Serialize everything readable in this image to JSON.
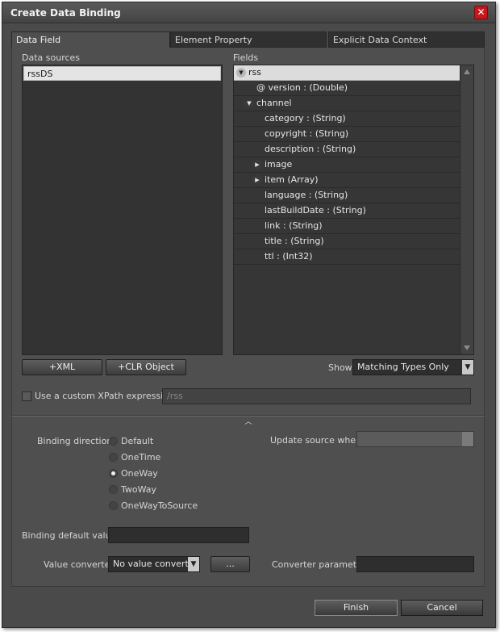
{
  "window": {
    "title": "Create Data Binding",
    "close_glyph": "✕"
  },
  "tabs": [
    {
      "label": "Data Field",
      "active": true
    },
    {
      "label": "Element Property",
      "active": false
    },
    {
      "label": "Explicit Data Context",
      "active": false
    }
  ],
  "data_sources": {
    "label": "Data sources",
    "items": [
      "rssDS"
    ],
    "selected": "rssDS"
  },
  "fields": {
    "label": "Fields",
    "rows": [
      {
        "text": "rss",
        "expander": "collapse-icon",
        "selected": true
      },
      {
        "text": "@ version : (Double)"
      },
      {
        "text": "channel",
        "expander": "collapse-icon"
      },
      {
        "text": "category : (String)"
      },
      {
        "text": "copyright : (String)"
      },
      {
        "text": "description : (String)"
      },
      {
        "text": "image",
        "expander": "expand-icon"
      },
      {
        "text": "item (Array)",
        "expander": "expand-icon"
      },
      {
        "text": "language : (String)"
      },
      {
        "text": "lastBuildDate : (String)"
      },
      {
        "text": "link : (String)"
      },
      {
        "text": "title : (String)"
      },
      {
        "text": "ttl : (Int32)"
      }
    ]
  },
  "buttons": {
    "add_xml": "+XML",
    "add_clr": "+CLR Object",
    "ellipsis": "...",
    "finish": "Finish",
    "cancel": "Cancel"
  },
  "show": {
    "label": "Show",
    "value": "Matching Types Only"
  },
  "xpath": {
    "label": "Use a custom XPath expression",
    "checked": false,
    "value": "/rss"
  },
  "binding_direction": {
    "label": "Binding direction",
    "options": [
      "Default",
      "OneTime",
      "OneWay",
      "TwoWay",
      "OneWayToSource"
    ],
    "selected": "OneWay"
  },
  "update_source": {
    "label": "Update source when",
    "value": ""
  },
  "binding_default": {
    "label": "Binding default value",
    "value": ""
  },
  "value_converter": {
    "label": "Value converter",
    "value": "No value converter"
  },
  "converter_parameter": {
    "label": "Converter parameter",
    "value": ""
  },
  "colors": {
    "accent_close": "#c8171b",
    "panel": "#4f4f4f",
    "list_bg": "#333333"
  }
}
